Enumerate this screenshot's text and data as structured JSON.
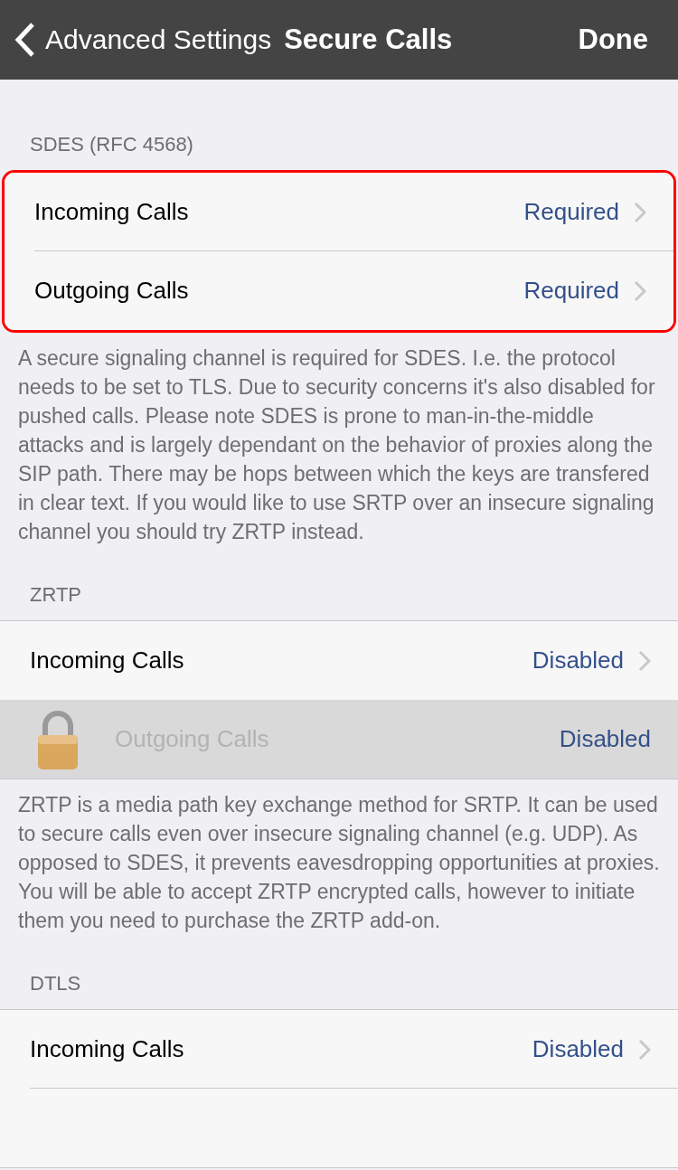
{
  "nav": {
    "back_label": "Advanced Settings",
    "title": "Secure Calls",
    "done": "Done"
  },
  "sections": [
    {
      "header": "SDES (RFC 4568)",
      "highlighted": true,
      "rows": [
        {
          "kind": "link",
          "label": "Incoming Calls",
          "value": "Required"
        },
        {
          "kind": "link",
          "label": "Outgoing Calls",
          "value": "Required"
        }
      ],
      "footer": "A secure signaling channel is required for SDES. I.e. the protocol needs to be set to TLS. Due to security concerns it's also disabled for pushed calls. Please note SDES is prone to man-in-the-middle attacks and is largely dependant on the behavior of proxies along the SIP path. There may be hops between which the keys are transfered in clear text. If you would like to use SRTP over an insecure signaling channel you should try ZRTP instead."
    },
    {
      "header": "ZRTP",
      "highlighted": false,
      "rows": [
        {
          "kind": "link",
          "label": "Incoming Calls",
          "value": "Disabled"
        },
        {
          "kind": "locked",
          "label": "Outgoing Calls",
          "value": "Disabled"
        }
      ],
      "footer": "ZRTP is a media path key exchange method for SRTP. It can be used to secure calls even over insecure signaling channel (e.g. UDP). As opposed to SDES, it prevents eavesdropping opportunities at proxies. You will be able to accept ZRTP encrypted calls, however to initiate them you need to purchase the ZRTP add-on."
    },
    {
      "header": "DTLS",
      "highlighted": false,
      "rows": [
        {
          "kind": "link",
          "label": "Incoming Calls",
          "value": "Disabled"
        },
        {
          "kind": "cutoff"
        }
      ]
    }
  ]
}
